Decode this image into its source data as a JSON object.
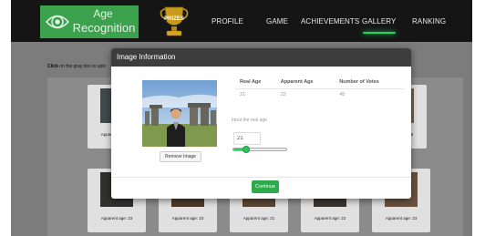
{
  "logo": {
    "line1": "Age",
    "line2": "Recognition"
  },
  "nav": {
    "prizes": "PRIZES",
    "links": [
      "PROFILE",
      "GAME",
      "ACHIEVEMENTS",
      "GALLERY",
      "RANKING"
    ],
    "active": "GALLERY"
  },
  "instruction": {
    "bold": "Click",
    "rest": " on the gray box to uplo"
  },
  "gallery": {
    "top_captions": [
      "Apparent age: 27",
      "Apparent age: 26"
    ],
    "bottom_captions": [
      "Apparent age: 23",
      "Apparent age: 23",
      "Apparent age: 21",
      "Apparent age: 22",
      "Apparent age: 23"
    ]
  },
  "modal": {
    "title": "Image Information",
    "table": {
      "headers": [
        "Real Age",
        "Apparent Age",
        "Number of Votes"
      ],
      "values": [
        "21",
        "22",
        "45"
      ]
    },
    "input_label": "Input the real age",
    "input_value": "21",
    "slider_fraction": 0.25,
    "remove_button": "Remove Image",
    "continue_button": "Continue"
  },
  "colors": {
    "brand_green": "#3ca14c",
    "active_underline": "#1ed760",
    "button_green": "#2ea94b",
    "nav_bg": "#151515"
  }
}
